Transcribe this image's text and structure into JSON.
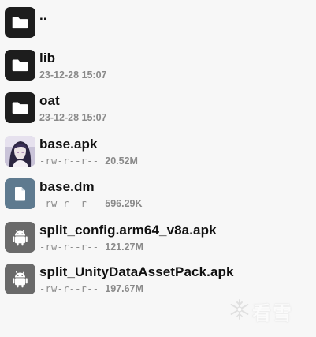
{
  "files": [
    {
      "kind": "folder",
      "icon": "folder-icon",
      "name": "..",
      "perm": "",
      "detail": ""
    },
    {
      "kind": "folder",
      "icon": "folder-icon",
      "name": "lib",
      "perm": "",
      "detail": "23-12-28 15:07"
    },
    {
      "kind": "folder",
      "icon": "folder-icon",
      "name": "oat",
      "perm": "",
      "detail": "23-12-28 15:07"
    },
    {
      "kind": "thumb",
      "icon": "app-thumbnail-icon",
      "name": "base.apk",
      "perm": "-rw-r--r--",
      "detail": "20.52M"
    },
    {
      "kind": "doc",
      "icon": "document-icon",
      "name": "base.dm",
      "perm": "-rw-r--r--",
      "detail": "596.29K"
    },
    {
      "kind": "android",
      "icon": "android-icon",
      "name": "split_config.arm64_v8a.apk",
      "perm": "-rw-r--r--",
      "detail": "121.27M"
    },
    {
      "kind": "android",
      "icon": "android-icon",
      "name": "split_UnityDataAssetPack.apk",
      "perm": "-rw-r--r--",
      "detail": "197.67M"
    }
  ],
  "watermark": {
    "icon": "snowflake-logo-icon",
    "text": "看雪"
  },
  "colors": {
    "background": "#f7f7f7",
    "folder_icon_bg": "#1d1d1d",
    "android_icon_bg": "#6a6a6a",
    "document_icon_bg": "#5e7a8f",
    "meta_text": "#8a8a8a"
  }
}
